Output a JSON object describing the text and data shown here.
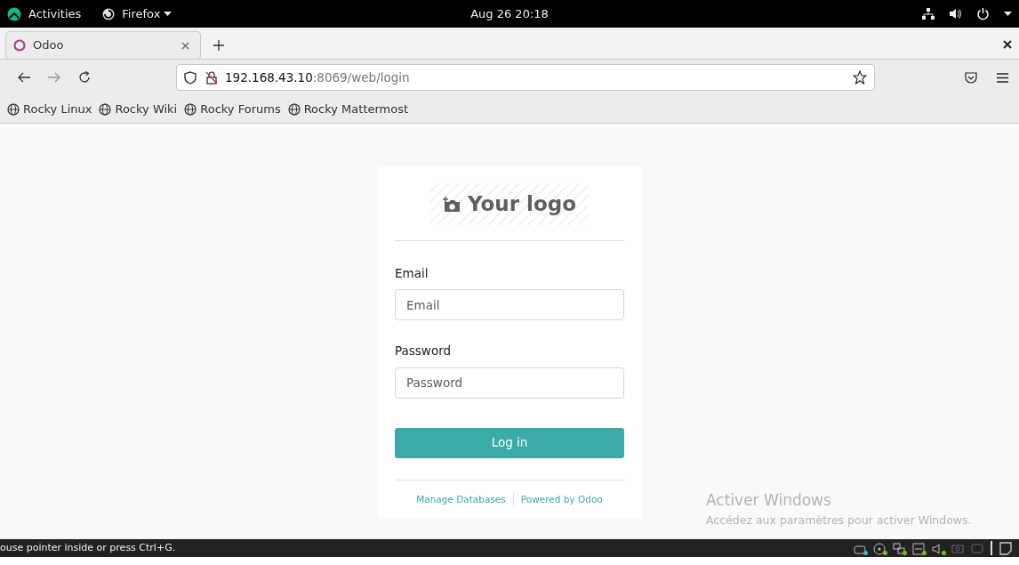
{
  "top_bar": {
    "activities": "Activities",
    "app_menu": "Firefox",
    "clock": "Aug 26  20:18"
  },
  "tabs": [
    {
      "label": "Odoo",
      "selected": true
    }
  ],
  "address_bar": {
    "host": "192.168.43.10",
    "path": ":8069/web/login"
  },
  "bookmarks": [
    "Rocky Linux",
    "Rocky Wiki",
    "Rocky Forums",
    "Rocky Mattermost"
  ],
  "login": {
    "logo_text": "Your logo",
    "fields": [
      {
        "label": "Email",
        "placeholder": "Email"
      },
      {
        "label": "Password",
        "placeholder": "Password"
      }
    ],
    "button": "Log in",
    "links": [
      "Manage Databases",
      "Powered by Odoo"
    ]
  },
  "activation_notice": {
    "title": "Activer Windows",
    "text": "Accédez aux paramètres pour activer Windows."
  },
  "status_bar": {
    "hint": "ouse pointer inside or press Ctrl+G.",
    "tray": [
      {
        "color": "#29c0c8"
      },
      {
        "color": "#6cc417"
      },
      {
        "color": "#6cc417"
      },
      {
        "color": "#6cc417"
      },
      {
        "color": "#6cc417"
      }
    ]
  }
}
